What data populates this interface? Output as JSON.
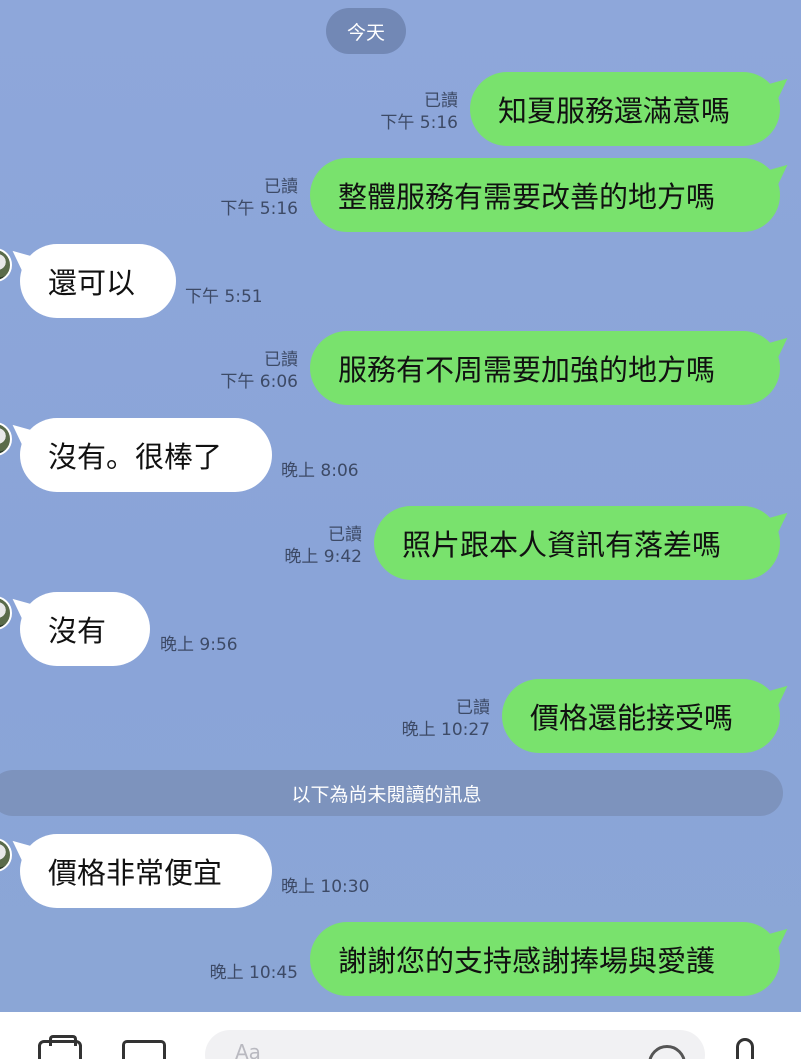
{
  "date_chip": "今天",
  "messages": [
    {
      "side": "out",
      "text": "知夏服務還滿意嗎",
      "read": "已讀",
      "time": "下午 5:16"
    },
    {
      "side": "out",
      "text": "整體服務有需要改善的地方嗎",
      "read": "已讀",
      "time": "下午 5:16"
    },
    {
      "side": "in",
      "text": "還可以",
      "time": "下午 5:51"
    },
    {
      "side": "out",
      "text": "服務有不周需要加強的地方嗎",
      "read": "已讀",
      "time": "下午 6:06"
    },
    {
      "side": "in",
      "text": "沒有。很棒了",
      "time": "晚上 8:06"
    },
    {
      "side": "out",
      "text": "照片跟本人資訊有落差嗎",
      "read": "已讀",
      "time": "晚上 9:42"
    },
    {
      "side": "in",
      "text": "沒有",
      "time": "晚上 9:56"
    },
    {
      "side": "out",
      "text": "價格還能接受嗎",
      "read": "已讀",
      "time": "晚上 10:27"
    },
    {
      "side": "in",
      "text": "價格非常便宜",
      "time": "晚上 10:30"
    },
    {
      "side": "out",
      "text": "謝謝您的支持感謝捧場與愛護",
      "read": "",
      "time": "晚上 10:45"
    }
  ],
  "unread_divider": "以下為尚未閱讀的訊息",
  "toolbar": {
    "camera_icon": "camera-icon",
    "image_icon": "image-icon",
    "emoji_icon": "emoji-icon",
    "mic_icon": "microphone-icon",
    "input_placeholder": "Aa"
  },
  "colors": {
    "background": "#8aa3d6",
    "outgoing_bubble": "#79e26d",
    "incoming_bubble": "#ffffff",
    "chip": "#7288b5"
  }
}
